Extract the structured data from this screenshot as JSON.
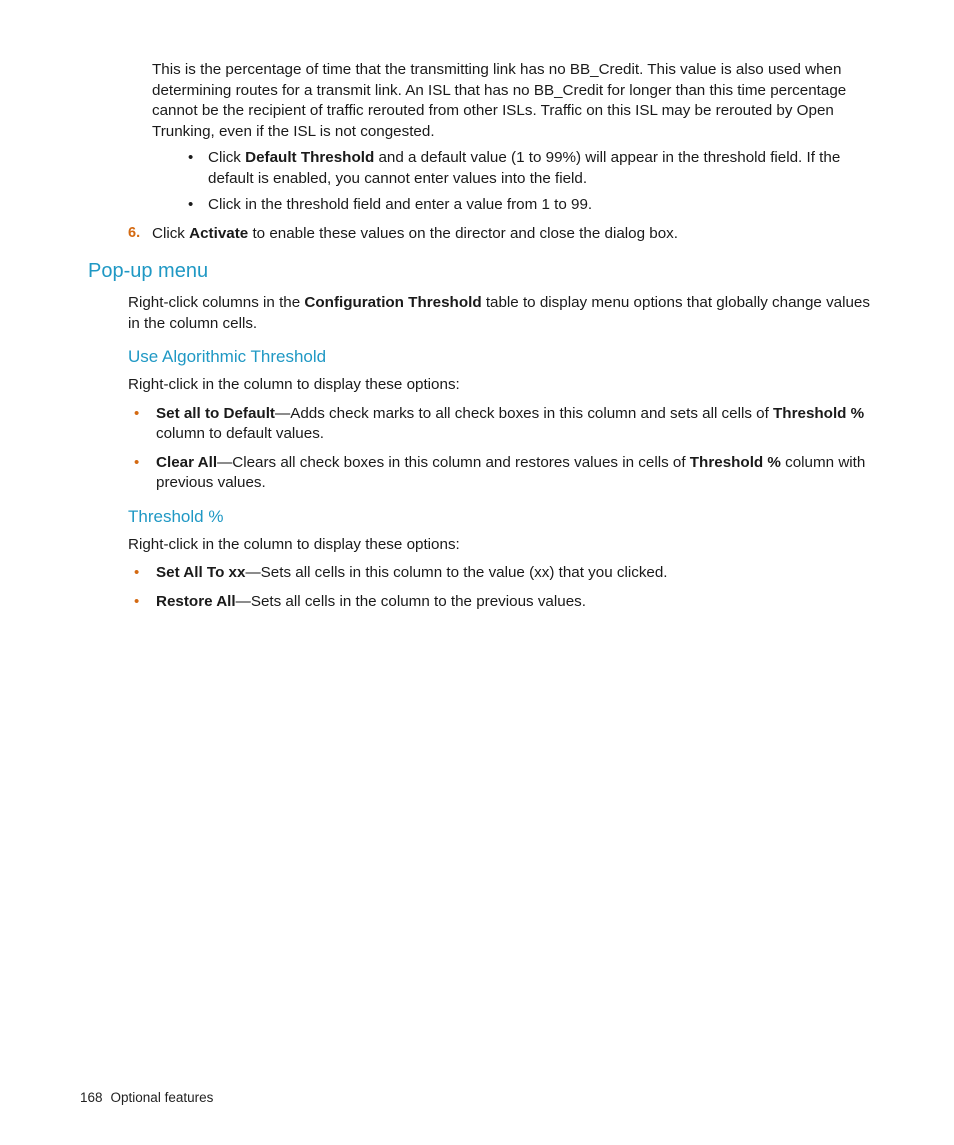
{
  "intro_para": "This is the percentage of time that the transmitting link has no BB_Credit. This value is also used when determining routes for a transmit link. An ISL that has no BB_Credit for longer than this time percentage cannot be the recipient of traffic rerouted from other ISLs. Traffic on this ISL may be rerouted by Open Trunking, even if the ISL is not congested.",
  "sub_bullets": {
    "b1_pre": "Click ",
    "b1_bold": "Default Threshold",
    "b1_post": " and a default value (1 to 99%) will appear in the threshold field. If the default is enabled, you cannot enter values into the field.",
    "b2": "Click in the threshold field and enter a value from 1 to 99."
  },
  "step6": {
    "num": "6.",
    "pre": "Click ",
    "bold": "Activate",
    "post": " to enable these values on the director and close the dialog box."
  },
  "popup_heading": "Pop-up menu",
  "popup_para_pre": "Right-click columns in the ",
  "popup_para_bold": "Configuration Threshold",
  "popup_para_post": " table to display menu options that globally change values in the column cells.",
  "ua_heading": "Use Algorithmic Threshold",
  "ua_para": "Right-click in the column to display these options:",
  "ua_bullets": {
    "b1_bold": "Set all to Default",
    "b1_mid": "—Adds check marks to all check boxes in this column and sets all cells of ",
    "b1_bold2": "Threshold %",
    "b1_post": " column to default values.",
    "b2_bold": "Clear All",
    "b2_mid": "—Clears all check boxes in this column and restores values in cells of ",
    "b2_bold2": "Threshold %",
    "b2_post": " column with previous values."
  },
  "th_heading": "Threshold %",
  "th_para": "Right-click in the column to display these options:",
  "th_bullets": {
    "b1_bold": "Set All To xx",
    "b1_post": "—Sets all cells in this column to the value (xx) that you clicked.",
    "b2_bold": "Restore All",
    "b2_post": "—Sets all cells in the column to the previous values."
  },
  "footer": {
    "page_num": "168",
    "section": "Optional features"
  }
}
